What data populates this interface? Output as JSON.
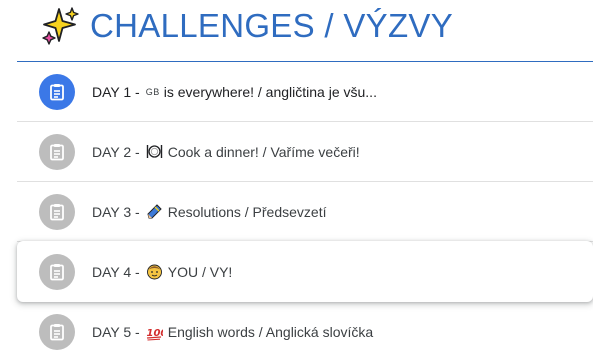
{
  "header": {
    "title": "CHALLENGES / VÝZVY",
    "icon": "sparkles-icon"
  },
  "colors": {
    "accent": "#2f6cc0",
    "done_icon": "#3b78e7",
    "pending_icon": "#bdbdbd"
  },
  "items": [
    {
      "day": "DAY 1 -",
      "badge": "GB",
      "title": "is everywhere! / angličtina je všu...",
      "icon": "assignment-icon"
    },
    {
      "day": "DAY 2 -",
      "emoji": "plate-fork-knife-icon",
      "title": "Cook a dinner! / Vaříme večeři!",
      "icon": "assignment-icon"
    },
    {
      "day": "DAY 3 -",
      "emoji": "crayon-icon",
      "title": "Resolutions / Předsevzetí",
      "icon": "assignment-icon"
    },
    {
      "day": "DAY 4 -",
      "emoji": "face-icon",
      "title": "YOU / VY!",
      "icon": "assignment-icon"
    },
    {
      "day": "DAY 5 -",
      "emoji": "hundred-points-icon",
      "title": "English words / Anglická slovíčka",
      "icon": "assignment-icon"
    }
  ]
}
